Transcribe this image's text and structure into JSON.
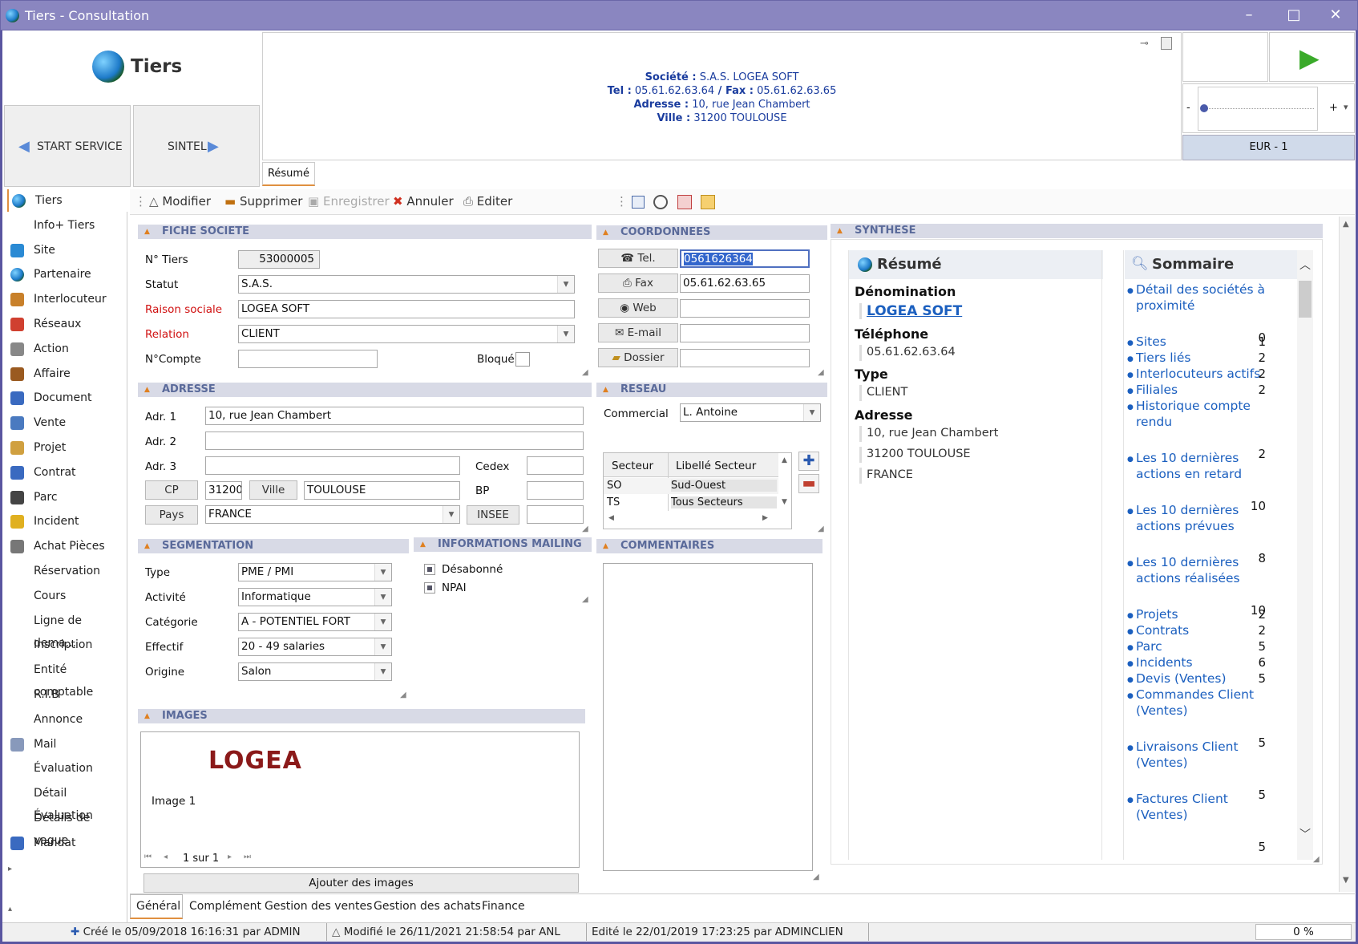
{
  "window": {
    "title": "Tiers - Consultation"
  },
  "module": {
    "title": "Tiers"
  },
  "header_buttons": {
    "prev": "START SERVICE",
    "next": "SINTEL"
  },
  "company_info": {
    "societe_label": "Société :",
    "societe": "S.A.S. LOGEA SOFT",
    "tel_label": "Tel :",
    "tel": "05.61.62.63.64",
    "fax_label": " / Fax :",
    "fax": "05.61.62.63.65",
    "adresse_label": "Adresse :",
    "adresse": "10, rue Jean Chambert",
    "ville_label": "Ville :",
    "ville": "31200 TOULOUSE"
  },
  "header_tab": "Résumé",
  "currency": "EUR - 1",
  "slider_minus": "-",
  "slider_plus": "+",
  "slider_level": 0.0,
  "sidebar": {
    "items": [
      {
        "label": "Tiers",
        "icon": "globe-icon",
        "color": "#2a8ad4"
      },
      {
        "label": "Info+ Tiers",
        "icon": "",
        "color": ""
      },
      {
        "label": "Site",
        "icon": "site-icon",
        "color": "#2a8ad4"
      },
      {
        "label": "Partenaire",
        "icon": "globe-icon",
        "color": "#2a8ad4"
      },
      {
        "label": "Interlocuteur",
        "icon": "handshake-icon",
        "color": "#c8802a"
      },
      {
        "label": "Réseaux",
        "icon": "network-icon",
        "color": "#d04030"
      },
      {
        "label": "Action",
        "icon": "action-icon",
        "color": "#888888"
      },
      {
        "label": "Affaire",
        "icon": "affaire-icon",
        "color": "#9a5a20"
      },
      {
        "label": "Document",
        "icon": "document-icon",
        "color": "#3a6ac0"
      },
      {
        "label": "Vente",
        "icon": "chart-icon",
        "color": "#4a7ac0"
      },
      {
        "label": "Projet",
        "icon": "project-icon",
        "color": "#d0a040"
      },
      {
        "label": "Contrat",
        "icon": "contract-icon",
        "color": "#3a6ac0"
      },
      {
        "label": "Parc",
        "icon": "parc-icon",
        "color": "#444444"
      },
      {
        "label": "Incident",
        "icon": "incident-icon",
        "color": "#e0b020"
      },
      {
        "label": "Achat Pièces",
        "icon": "wrench-icon",
        "color": "#777777"
      },
      {
        "label": "Réservation",
        "icon": "",
        "color": ""
      },
      {
        "label": "Cours",
        "icon": "",
        "color": ""
      },
      {
        "label": "Ligne de dema...",
        "icon": "",
        "color": ""
      },
      {
        "label": "Inscription",
        "icon": "",
        "color": ""
      },
      {
        "label": "Entité comptable",
        "icon": "",
        "color": ""
      },
      {
        "label": "R.I.B",
        "icon": "",
        "color": ""
      },
      {
        "label": "Annonce",
        "icon": "",
        "color": ""
      },
      {
        "label": "Mail",
        "icon": "mail-icon",
        "color": "#8899bb"
      },
      {
        "label": "Évaluation",
        "icon": "",
        "color": ""
      },
      {
        "label": "Détail Évaluation",
        "icon": "",
        "color": ""
      },
      {
        "label": "Détails de vague",
        "icon": "",
        "color": ""
      },
      {
        "label": "Mandat",
        "icon": "mandat-icon",
        "color": "#3a6ac0"
      }
    ]
  },
  "toolbar": {
    "modifier": "Modifier",
    "supprimer": "Supprimer",
    "enregistrer": "Enregistrer",
    "annuler": "Annuler",
    "editer": "Editer"
  },
  "fiche": {
    "header": "FICHE SOCIETE",
    "num_label": "N° Tiers",
    "num": "53000005",
    "statut_label": "Statut",
    "statut": "S.A.S.",
    "raison_label": "Raison sociale",
    "raison": "LOGEA SOFT",
    "relation_label": "Relation",
    "relation": "CLIENT",
    "compte_label": "N°Compte",
    "compte": "",
    "bloque_label": "Bloqué"
  },
  "adresse": {
    "header": "ADRESSE",
    "adr1_label": "Adr. 1",
    "adr1": "10, rue Jean Chambert",
    "adr2_label": "Adr. 2",
    "adr2": "",
    "adr3_label": "Adr. 3",
    "adr3": "",
    "cedex_label": "Cedex",
    "cedex": "",
    "cp_btn": "CP",
    "cp": "31200",
    "ville_btn": "Ville",
    "ville": "TOULOUSE",
    "bp_label": "BP",
    "bp": "",
    "pays_btn": "Pays",
    "pays": "FRANCE",
    "insee_btn": "INSEE",
    "insee": ""
  },
  "segmentation": {
    "header": "SEGMENTATION",
    "type_label": "Type",
    "type": "PME / PMI",
    "activite_label": "Activité",
    "activite": "Informatique",
    "categorie_label": "Catégorie",
    "categorie": "A - POTENTIEL FORT",
    "effectif_label": "Effectif",
    "effectif": "20 - 49 salaries",
    "origine_label": "Origine",
    "origine": "Salon"
  },
  "mailing": {
    "header": "INFORMATIONS MAILING",
    "desabonne": "Désabonné",
    "npai": "NPAI"
  },
  "images": {
    "header": "IMAGES",
    "logo": "LOGEA",
    "caption": "Image 1",
    "pager": "1 sur 1",
    "add": "Ajouter des images"
  },
  "coordonnees": {
    "header": "COORDONNEES",
    "tel_btn": "Tel.",
    "tel": "0561626364",
    "fax_btn": "Fax",
    "fax": "05.61.62.63.65",
    "web_btn": "Web",
    "web": "",
    "email_btn": "E-mail",
    "email": "",
    "dossier_btn": "Dossier",
    "dossier": ""
  },
  "reseau": {
    "header": "RESEAU",
    "commercial_label": "Commercial",
    "commercial": "L. Antoine",
    "columns": [
      "Secteur",
      "Libellé Secteur"
    ],
    "rows": [
      [
        "SO",
        "Sud-Ouest"
      ],
      [
        "TS",
        "Tous Secteurs"
      ]
    ]
  },
  "commentaires": {
    "header": "COMMENTAIRES"
  },
  "synthese": {
    "header": "SYNTHESE",
    "resume_title": "Résumé",
    "denomination_label": "Dénomination",
    "denomination": "LOGEA SOFT",
    "telephone_label": "Téléphone",
    "telephone": "05.61.62.63.64",
    "type_label": "Type",
    "type": "CLIENT",
    "adresse_label": "Adresse",
    "adresse1": "10, rue Jean Chambert",
    "adresse2": "31200 TOULOUSE",
    "adresse3": "FRANCE",
    "sommaire_title": "Sommaire",
    "sommaire": [
      {
        "l1": "Détail des sociétés à",
        "l2": "proximité",
        "count": "0"
      },
      {
        "l1": "Sites",
        "l2": "",
        "count": "1"
      },
      {
        "l1": "Tiers liés",
        "l2": "",
        "count": "2"
      },
      {
        "l1": "Interlocuteurs actifs",
        "l2": "",
        "count": "2"
      },
      {
        "l1": "Filiales",
        "l2": "",
        "count": "2"
      },
      {
        "l1": "Historique compte",
        "l2": "rendu",
        "count": "2"
      },
      {
        "l1": "Les 10 dernières",
        "l2": "actions en retard",
        "count": "10"
      },
      {
        "l1": "Les 10 dernières",
        "l2": "actions prévues",
        "count": "8"
      },
      {
        "l1": "Les 10 dernières",
        "l2": "actions réalisées",
        "count": "10"
      },
      {
        "l1": "Projets",
        "l2": "",
        "count": "2"
      },
      {
        "l1": "Contrats",
        "l2": "",
        "count": "2"
      },
      {
        "l1": "Parc",
        "l2": "",
        "count": "5"
      },
      {
        "l1": "Incidents",
        "l2": "",
        "count": "6"
      },
      {
        "l1": "Devis (Ventes)",
        "l2": "",
        "count": "5"
      },
      {
        "l1": "Commandes Client",
        "l2": "(Ventes)",
        "count": "5"
      },
      {
        "l1": "Livraisons Client",
        "l2": "(Ventes)",
        "count": "5"
      },
      {
        "l1": "Factures Client",
        "l2": "(Ventes)",
        "count": "5"
      }
    ]
  },
  "bottom_tabs": [
    "Général",
    "Complément",
    "Gestion des ventes",
    "Gestion des achats",
    "Finance"
  ],
  "status": {
    "cree": "Créé le 05/09/2018 16:16:31 par ADMIN",
    "modifie": "Modifié le 26/11/2021 21:58:54 par ANL",
    "edite": "Edité le 22/01/2019 17:23:25 par ADMINCLIEN",
    "progress": "0 %"
  }
}
